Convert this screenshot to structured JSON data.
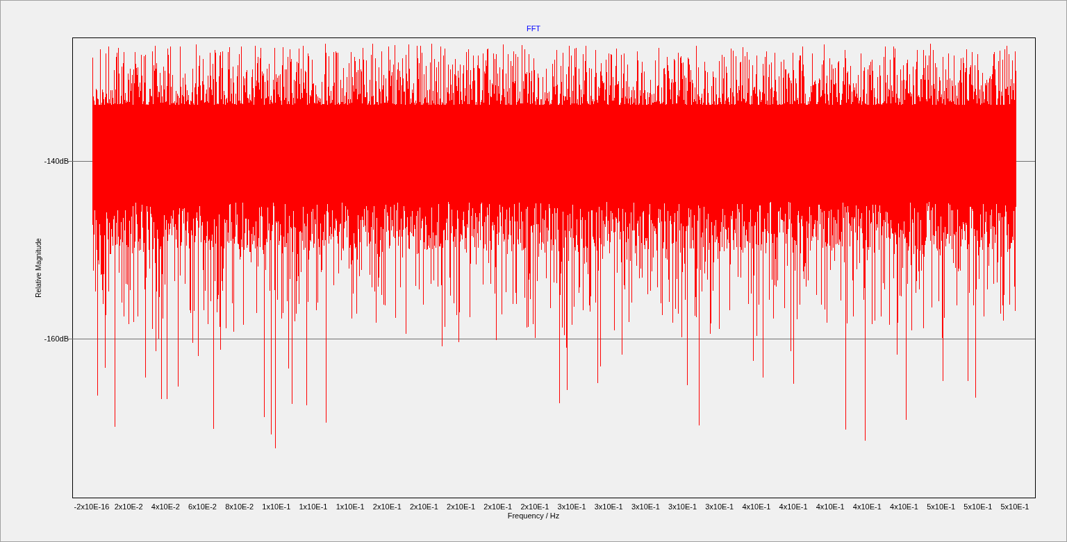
{
  "chart": {
    "title": "FFT",
    "ylabel": "Relative Magnitude",
    "xlabel": "Frequency / Hz",
    "yticks": [
      "-140dB",
      "-160dB"
    ],
    "xticks": [
      "-2x10E-16",
      "2x10E-2",
      "4x10E-2",
      "6x10E-2",
      "8x10E-2",
      "1x10E-1",
      "1x10E-1",
      "1x10E-1",
      "2x10E-1",
      "2x10E-1",
      "2x10E-1",
      "2x10E-1",
      "2x10E-1",
      "3x10E-1",
      "3x10E-1",
      "3x10E-1",
      "3x10E-1",
      "3x10E-1",
      "4x10E-1",
      "4x10E-1",
      "4x10E-1",
      "4x10E-1",
      "4x10E-1",
      "5x10E-1",
      "5x10E-1",
      "5x10E-1"
    ]
  }
}
